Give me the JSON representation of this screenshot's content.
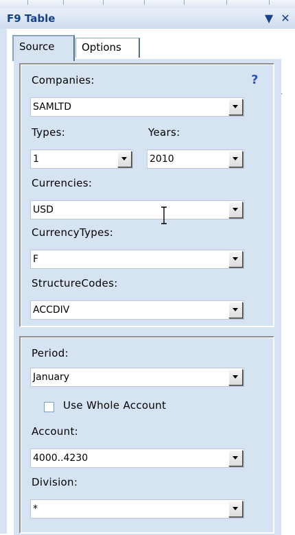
{
  "panel": {
    "title": "F9 Table",
    "dropdown_glyph": "▼",
    "close_glyph": "✕"
  },
  "tabs": [
    {
      "label": "Source",
      "active": true
    },
    {
      "label": "Options",
      "active": false
    }
  ],
  "source": {
    "companies_label": "Companies:",
    "help_label": "?",
    "companies_value": "SAMLTD",
    "types_label": "Types:",
    "types_value": "1",
    "years_label": "Years:",
    "years_value": "2010",
    "currencies_label": "Currencies:",
    "currencies_value": "USD",
    "currency_types_label": "CurrencyTypes:",
    "currency_types_value": "F",
    "structure_codes_label": "StructureCodes:",
    "structure_codes_value": "ACCDIV",
    "period_label": "Period:",
    "period_value": "January",
    "use_whole_account_label": "Use Whole Account",
    "use_whole_account_checked": false,
    "account_label": "Account:",
    "account_value": "4000..4230",
    "division_label": "Division:",
    "division_value": "*"
  },
  "colors": {
    "pane": "#d6e3f3",
    "title_text": "#15428b",
    "help": "#2a55c4"
  },
  "icons": {
    "close": "close-icon",
    "menu": "chevron-down-icon",
    "combo_arrow": "chevron-down-icon",
    "cursor": "text-cursor-icon"
  }
}
